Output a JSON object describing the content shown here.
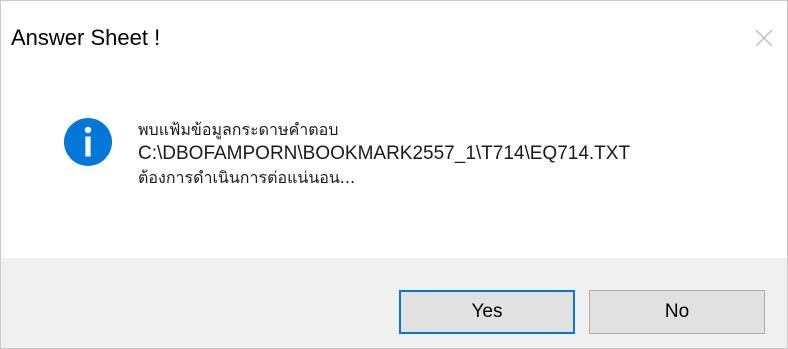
{
  "dialog": {
    "title": "Answer Sheet !",
    "close_icon": "close-icon",
    "message_icon": "info-icon",
    "message": {
      "line1": "พบแฟ้มข้อมูลกระดาษคำตอบ",
      "line2": "C:\\DBOFAMPORN\\BOOKMARK2557_1\\T714\\EQ714.TXT",
      "line3": "ต้องการดำเนินการต่อแน่นอน..."
    },
    "buttons": {
      "yes_label": "Yes",
      "no_label": "No",
      "default": "Yes"
    },
    "colors": {
      "icon_blue": "#0078d7",
      "footer_bg": "#f0f0f0",
      "focus_border": "#0078d7"
    }
  }
}
